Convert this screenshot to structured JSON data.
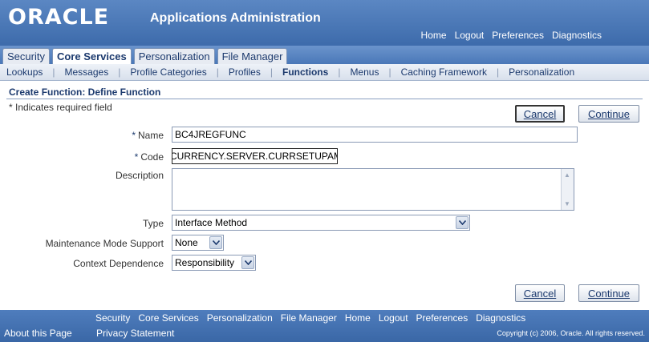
{
  "header": {
    "logo": "ORACLE",
    "title": "Applications Administration",
    "global_links": [
      "Home",
      "Logout",
      "Preferences",
      "Diagnostics"
    ]
  },
  "tabs": [
    {
      "label": "Security",
      "active": false
    },
    {
      "label": "Core Services",
      "active": true
    },
    {
      "label": "Personalization",
      "active": false
    },
    {
      "label": "File Manager",
      "active": false
    }
  ],
  "subtabs": [
    "Lookups",
    "Messages",
    "Profile Categories",
    "Profiles",
    "Functions",
    "Menus",
    "Caching Framework",
    "Personalization"
  ],
  "page": {
    "title": "Create Function: Define Function",
    "required_note": "* Indicates required field",
    "required_marker": "*"
  },
  "buttons": {
    "cancel": "Cancel",
    "continue": "Continue"
  },
  "form": {
    "name_label": "Name",
    "name_value": "BC4JREGFUNC",
    "code_label": "Code",
    "code_value": "CURRENCY.SERVER.CURRSETUPAM",
    "description_label": "Description",
    "description_value": "",
    "type_label": "Type",
    "type_value": "Interface Method",
    "maintenance_label": "Maintenance Mode Support",
    "maintenance_value": "None",
    "context_label": "Context Dependence",
    "context_value": "Responsibility"
  },
  "footer": {
    "links": [
      "Security",
      "Core Services",
      "Personalization",
      "File Manager",
      "Home",
      "Logout",
      "Preferences",
      "Diagnostics"
    ],
    "about": "About this Page",
    "privacy": "Privacy Statement",
    "copyright": "Copyright (c) 2006, Oracle. All rights reserved."
  }
}
